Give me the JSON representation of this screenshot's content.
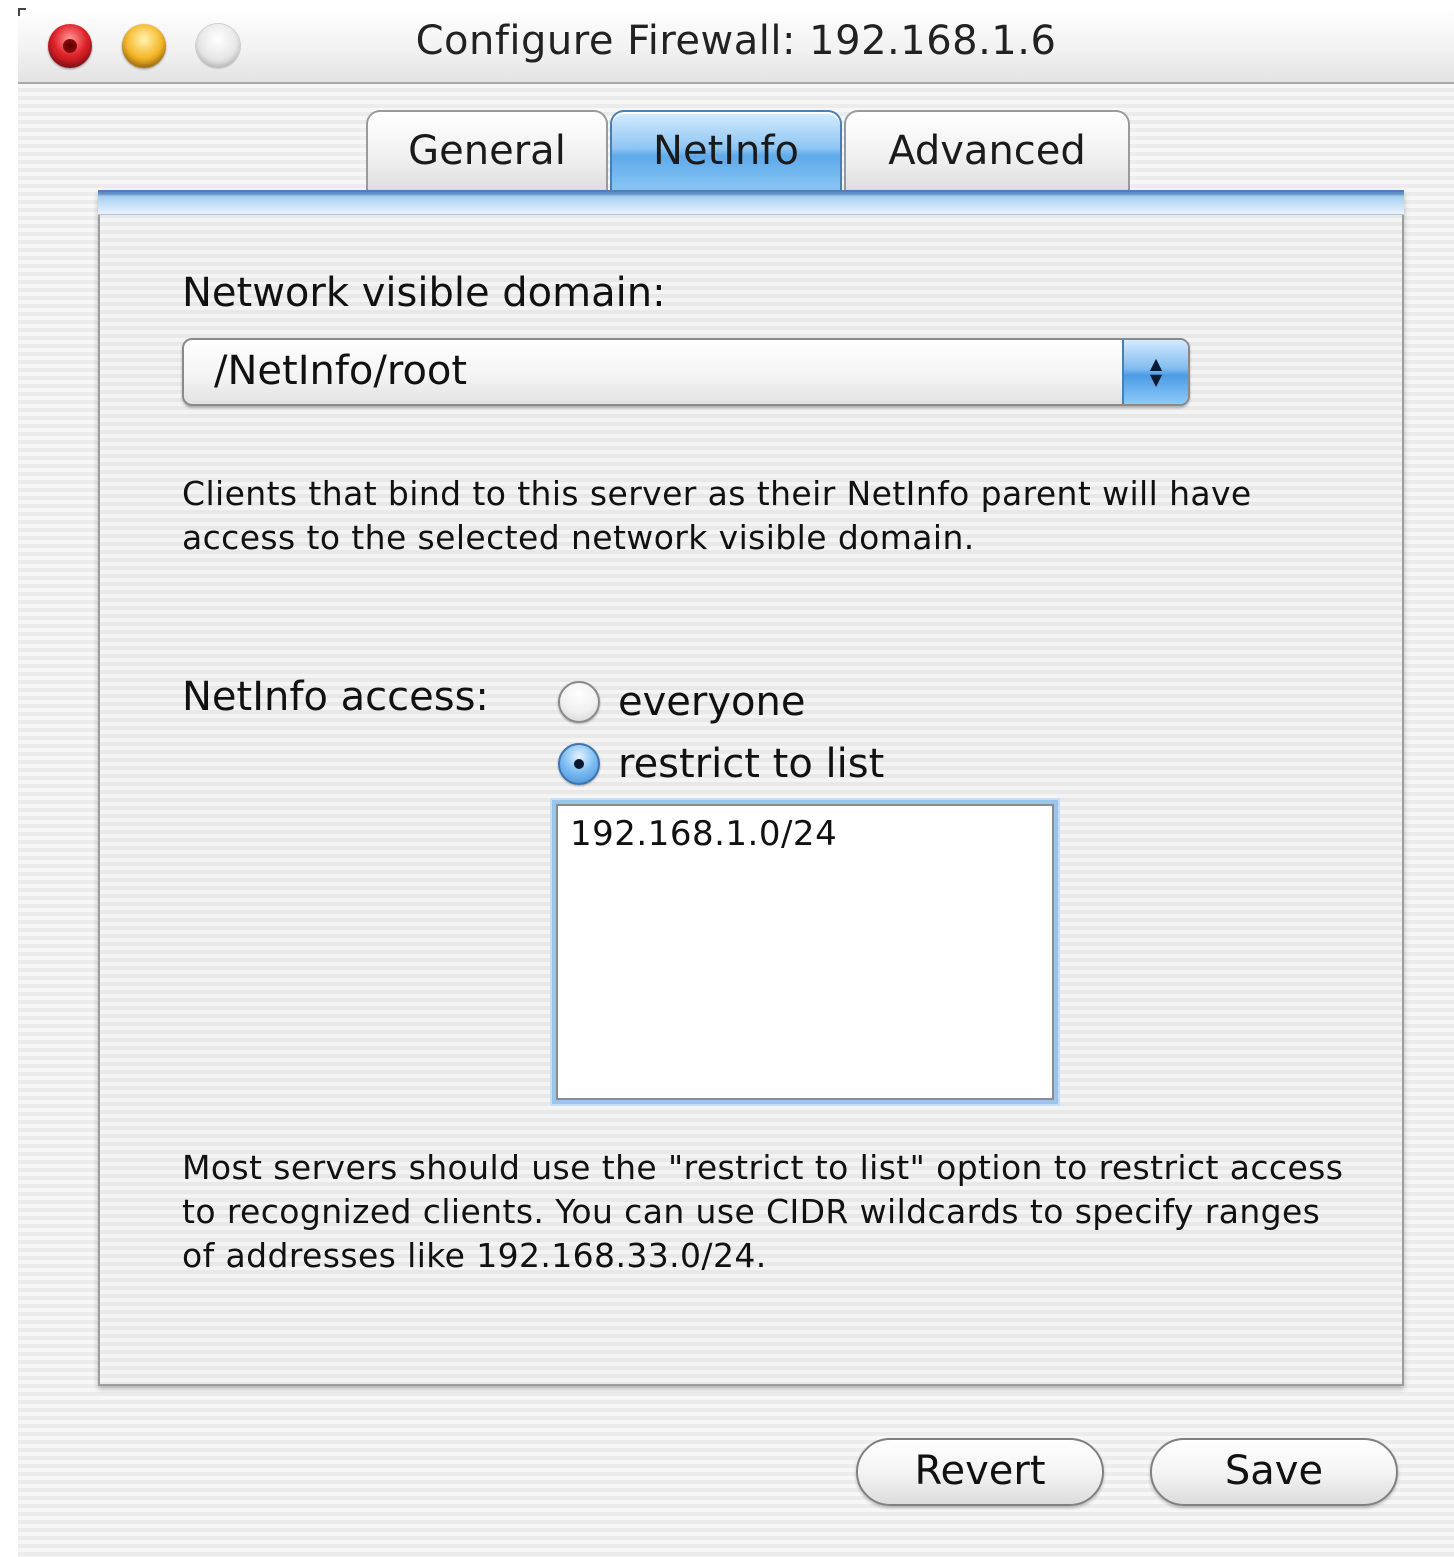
{
  "window": {
    "title": "Configure Firewall: 192.168.1.6"
  },
  "tabs": [
    {
      "label": "General",
      "selected": false
    },
    {
      "label": "NetInfo",
      "selected": true
    },
    {
      "label": "Advanced",
      "selected": false
    }
  ],
  "netinfo": {
    "domain_label": "Network visible domain:",
    "domain_value": "/NetInfo/root",
    "description": "Clients that bind to this server as their NetInfo parent will have access to the selected network visible domain.",
    "access_label": "NetInfo access:",
    "options": [
      {
        "label": "everyone",
        "selected": false
      },
      {
        "label": "restrict to list",
        "selected": true
      }
    ],
    "access_list": [
      "192.168.1.0/24"
    ],
    "help_text": "Most servers should use the \"restrict to list\" option to restrict access to recognized clients.  You can use CIDR wildcards to specify ranges of addresses like 192.168.33.0/24."
  },
  "buttons": {
    "revert": "Revert",
    "save": "Save"
  },
  "icons": {
    "close": "close-light-icon",
    "minimize": "minimize-light-icon",
    "zoom": "zoom-light-icon",
    "popup_arrows": "up-down-arrows-icon"
  },
  "colors": {
    "accent": "#5ea9ea",
    "close": "#e0232a",
    "minimize": "#f5b82a"
  }
}
